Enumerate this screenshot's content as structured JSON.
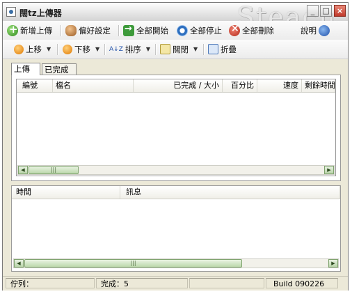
{
  "window": {
    "title": "闊tz上傳器",
    "watermark": "Steach",
    "controls": {
      "minimize": "_",
      "maximize": "□",
      "close": "×"
    }
  },
  "toolbar1": {
    "add_upload": "新增上傳",
    "preferences": "偏好設定",
    "start_all": "全部開始",
    "stop_all": "全部停止",
    "delete_all": "全部刪除",
    "about": "說明",
    "icons": [
      "plus-icon",
      "people-icon",
      "arrow-right-icon",
      "stop-icon",
      "delete-icon",
      "info-icon"
    ]
  },
  "toolbar2": {
    "move_up": "上移",
    "move_down": "下移",
    "sort": "排序",
    "close_item": "關閉",
    "collapse": "折疊",
    "sort_icon_text": "A↓Z",
    "dropdown_glyph": "▼"
  },
  "tabs": [
    {
      "label": "上傳",
      "active": true
    },
    {
      "label": "已完成",
      "active": false
    }
  ],
  "upload_list": {
    "columns": [
      "編號",
      "檔名",
      "已完成 / 大小",
      "百分比",
      "速度",
      "剩餘時間"
    ],
    "rows": []
  },
  "log_list": {
    "columns": [
      "時間",
      "訊息"
    ],
    "rows": []
  },
  "scrollbar": {
    "left": "◀",
    "right": "▶",
    "grip": "|||"
  },
  "status": {
    "queue_label": "佇列：",
    "done_label": "完成：5",
    "build": "Build 090226"
  },
  "colors": {
    "window_bg": "#ece9d8",
    "close_button": "#c0392b"
  }
}
